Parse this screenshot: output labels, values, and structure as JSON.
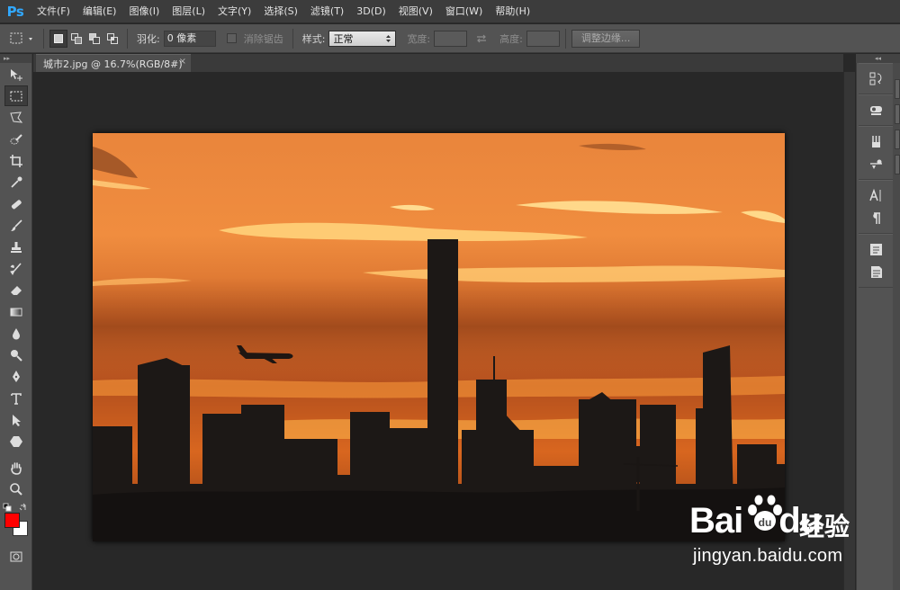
{
  "app": {
    "logo": "Ps",
    "menu": [
      "文件(F)",
      "编辑(E)",
      "图像(I)",
      "图层(L)",
      "文字(Y)",
      "选择(S)",
      "滤镜(T)",
      "3D(D)",
      "视图(V)",
      "窗口(W)",
      "帮助(H)"
    ]
  },
  "options": {
    "feather_label": "羽化:",
    "feather_value": "0 像素",
    "antialias_label": "消除锯齿",
    "style_label": "样式:",
    "style_value": "正常",
    "width_label": "宽度:",
    "height_label": "高度:",
    "refine_edge_label": "调整边缘..."
  },
  "document": {
    "tab_title": "城市2.jpg @ 16.7%(RGB/8#)",
    "close_glyph": "×"
  },
  "tools": [
    "move-tool",
    "marquee-tool",
    "lasso-tool",
    "quick-select-tool",
    "crop-tool",
    "eyedropper-tool",
    "healing-brush-tool",
    "brush-tool",
    "clone-stamp-tool",
    "history-brush-tool",
    "eraser-tool",
    "gradient-tool",
    "blur-tool",
    "dodge-tool",
    "pen-tool",
    "type-tool",
    "path-selection-tool",
    "shape-tool",
    "hand-tool",
    "zoom-tool"
  ],
  "colors": {
    "foreground": "#ff0000",
    "background": "#ffffff",
    "accent": "#31a8ff"
  },
  "watermark": {
    "brand": "Bai",
    "brand_suffix": "du",
    "jingyan": "经验",
    "url": "jingyan.baidu.com"
  }
}
